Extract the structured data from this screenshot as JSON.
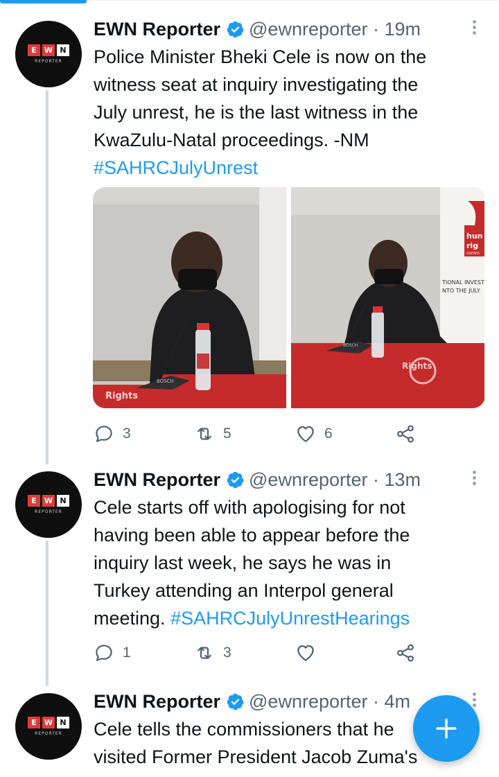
{
  "tweets": [
    {
      "author_name": "EWN Reporter",
      "handle": "@ewnreporter",
      "time": "19m",
      "avatar": {
        "logo": [
          "E",
          "W",
          "N"
        ],
        "subtitle": "REPORTER"
      },
      "lines": [
        "Police Minister Bheki Cele is now on the",
        "witness seat at inquiry investigating the",
        "July unrest, he is the last witness in the",
        "KwaZulu-Natal proceedings. -NM"
      ],
      "hashtag": "#SAHRCJulyUnrest",
      "media": {
        "photo1": {
          "mic_label": "BOSCH",
          "banner": "Rights"
        },
        "photo2": {
          "mic_label": "BOSCH",
          "sign_1": "hun",
          "sign_2": "rig",
          "sign_3": "comm",
          "banner_1": "TIONAL INVESTI",
          "banner_2": "NTO THE JULY",
          "table_banner": "Rights"
        }
      },
      "replies": "3",
      "retweets": "5",
      "likes": "6"
    },
    {
      "author_name": "EWN Reporter",
      "handle": "@ewnreporter",
      "time": "13m",
      "avatar": {
        "logo": [
          "E",
          "W",
          "N"
        ],
        "subtitle": "REPORTER"
      },
      "lines": [
        "Cele starts off with apologising for not",
        "having been able to appear before the",
        "inquiry last week, he says he was in",
        "Turkey attending an Interpol general"
      ],
      "last_line_prefix": "meeting.",
      "hashtag": "#SAHRCJulyUnrestHearings",
      "replies": "1",
      "retweets": "3",
      "likes": ""
    },
    {
      "author_name": "EWN Reporter",
      "handle": "@ewnreporter",
      "time": "4m",
      "avatar": {
        "logo": [
          "E",
          "W",
          "N"
        ],
        "subtitle": "REPORTER"
      },
      "lines": [
        "Cele tells the commissioners that he",
        "visited Former President Jacob Zuma's"
      ]
    }
  ],
  "fab": {
    "icon": "plus-icon"
  },
  "colors": {
    "accent": "#1d9bf0",
    "text": "#0f1419",
    "secondary": "#536471",
    "thread": "#cfd9de",
    "ewn_red": "#e23a3a"
  }
}
